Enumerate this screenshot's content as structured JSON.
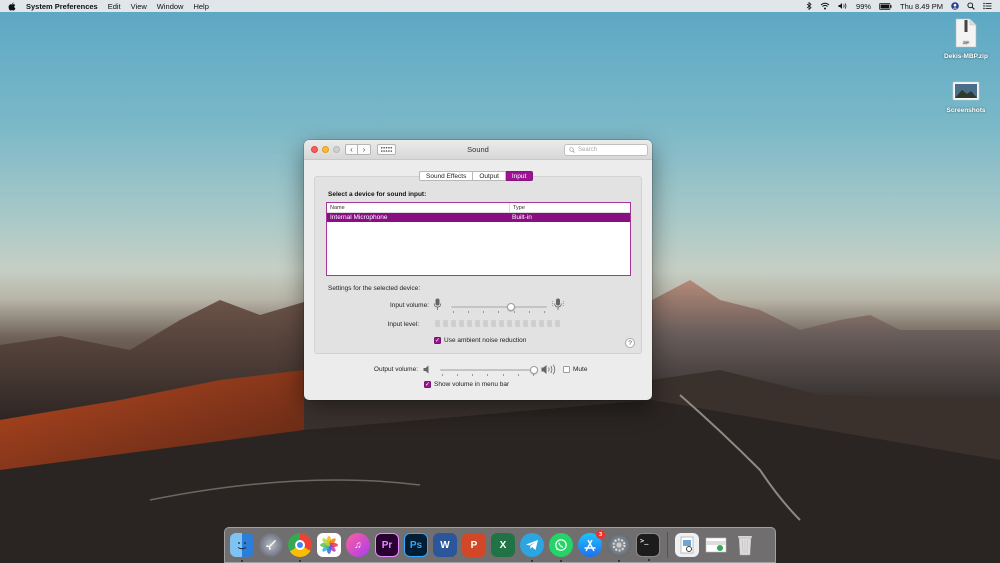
{
  "menubar": {
    "app_name": "System Preferences",
    "items": [
      "Edit",
      "View",
      "Window",
      "Help"
    ],
    "battery": "99%",
    "clock": "Thu 8.49 PM"
  },
  "desktop": {
    "icons": [
      {
        "label": "Dekis-MBP.zip",
        "icon": "zip-file-icon"
      },
      {
        "label": "Screenshots",
        "icon": "folder-image-icon"
      }
    ]
  },
  "window": {
    "title": "Sound",
    "search_placeholder": "Search",
    "tabs": [
      {
        "label": "Sound Effects",
        "active": false
      },
      {
        "label": "Output",
        "active": false
      },
      {
        "label": "Input",
        "active": true
      }
    ],
    "select_label": "Select a device for sound input:",
    "table": {
      "columns": [
        "Name",
        "Type"
      ],
      "rows": [
        {
          "name": "Internal Microphone",
          "type": "Built-in",
          "selected": true
        }
      ]
    },
    "settings_label": "Settings for the selected device:",
    "input_volume_label": "Input volume:",
    "input_volume_value": 0.62,
    "input_level_label": "Input level:",
    "ambient_label": "Use ambient noise reduction",
    "ambient_checked": true,
    "help": "?",
    "output_volume_label": "Output volume:",
    "output_volume_value": 0.98,
    "mute_label": "Mute",
    "mute_checked": false,
    "show_volume_label": "Show volume in menu bar",
    "show_volume_checked": true
  },
  "colors": {
    "accent": "#9a1590",
    "selection": "#870f82"
  },
  "dock": {
    "apps": [
      {
        "name": "finder-icon",
        "running": true
      },
      {
        "name": "launchpad-icon",
        "running": false
      },
      {
        "name": "chrome-icon",
        "running": true
      },
      {
        "name": "photos-icon",
        "running": false
      },
      {
        "name": "itunes-icon",
        "running": false
      },
      {
        "name": "premiere-icon",
        "label": "Pr",
        "running": false
      },
      {
        "name": "photoshop-icon",
        "label": "Ps",
        "running": false
      },
      {
        "name": "word-icon",
        "label": "W",
        "running": false
      },
      {
        "name": "powerpoint-icon",
        "label": "P",
        "running": false
      },
      {
        "name": "excel-icon",
        "label": "X",
        "running": false
      },
      {
        "name": "telegram-icon",
        "running": true
      },
      {
        "name": "whatsapp-icon",
        "running": true
      },
      {
        "name": "app-store-icon",
        "badge": "3",
        "running": false
      },
      {
        "name": "system-preferences-icon",
        "running": true
      },
      {
        "name": "terminal-icon",
        "running": true
      },
      {
        "name": "preview-icon",
        "running": false
      },
      {
        "name": "downloads-stack-icon",
        "running": false
      },
      {
        "name": "trash-icon",
        "running": false
      }
    ]
  }
}
